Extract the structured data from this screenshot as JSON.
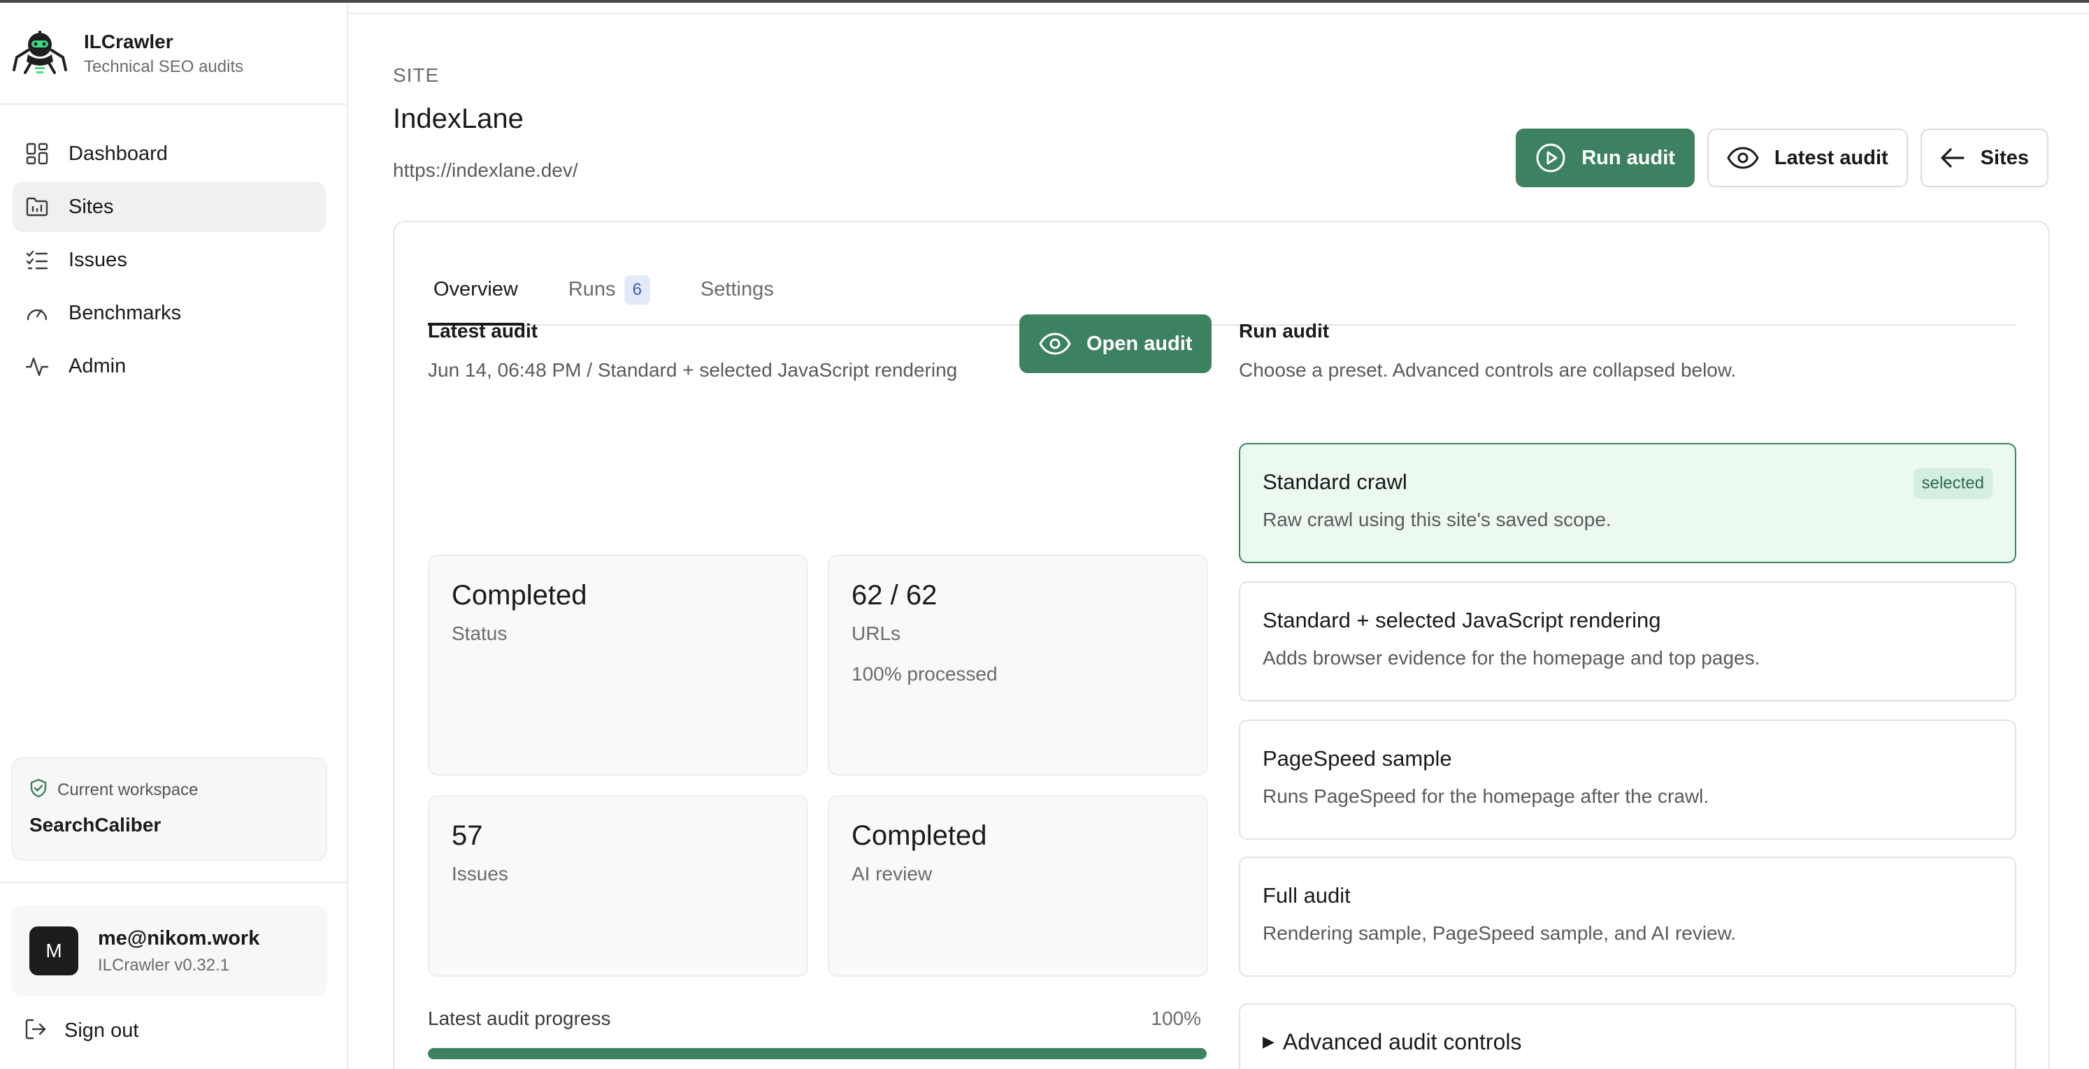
{
  "app": {
    "name": "ILCrawler",
    "tagline": "Technical SEO audits"
  },
  "sidebar": {
    "items": [
      {
        "label": "Dashboard",
        "icon": "dashboard-icon",
        "active": false
      },
      {
        "label": "Sites",
        "icon": "sites-icon",
        "active": true
      },
      {
        "label": "Issues",
        "icon": "issues-icon",
        "active": false
      },
      {
        "label": "Benchmarks",
        "icon": "gauge-icon",
        "active": false
      },
      {
        "label": "Admin",
        "icon": "activity-icon",
        "active": false
      }
    ],
    "workspace_label": "Current workspace",
    "workspace_name": "SearchCaliber",
    "user": {
      "initial": "M",
      "email": "me@nikom.work",
      "version": "ILCrawler v0.32.1"
    },
    "sign_out": "Sign out"
  },
  "header": {
    "eyebrow": "SITE",
    "title": "IndexLane",
    "url": "https://indexlane.dev/",
    "actions": {
      "run_audit": "Run audit",
      "latest_audit": "Latest audit",
      "sites": "Sites"
    }
  },
  "tabs": [
    {
      "label": "Overview",
      "active": true
    },
    {
      "label": "Runs",
      "badge": "6",
      "active": false
    },
    {
      "label": "Settings",
      "active": false
    }
  ],
  "latest_audit": {
    "title": "Latest audit",
    "meta": "Jun 14, 06:48 PM / Standard + selected JavaScript rendering",
    "open_button": "Open audit",
    "stats": [
      {
        "value": "Completed",
        "label": "Status",
        "sub": ""
      },
      {
        "value": "62 / 62",
        "label": "URLs",
        "sub": "100% processed"
      },
      {
        "value": "57",
        "label": "Issues",
        "sub": ""
      },
      {
        "value": "Completed",
        "label": "AI review",
        "sub": ""
      }
    ],
    "progress_label": "Latest audit progress",
    "progress_text": "100%",
    "progress": 1.0
  },
  "run_audit": {
    "title": "Run audit",
    "subtitle": "Choose a preset. Advanced controls are collapsed below.",
    "presets": [
      {
        "name": "Standard crawl",
        "desc": "Raw crawl using this site's saved scope.",
        "selected": true,
        "badge": "selected"
      },
      {
        "name": "Standard + selected JavaScript rendering",
        "desc": "Adds browser evidence for the homepage and top pages.",
        "selected": false
      },
      {
        "name": "PageSpeed sample",
        "desc": "Runs PageSpeed for the homepage after the crawl.",
        "selected": false
      },
      {
        "name": "Full audit",
        "desc": "Rendering sample, PageSpeed sample, and AI review.",
        "selected": false
      }
    ],
    "advanced_label": "Advanced audit controls"
  },
  "colors": {
    "accent": "#3d8260",
    "selected_bg": "#ebf9f1",
    "badge_bg": "#e3eaf7"
  }
}
